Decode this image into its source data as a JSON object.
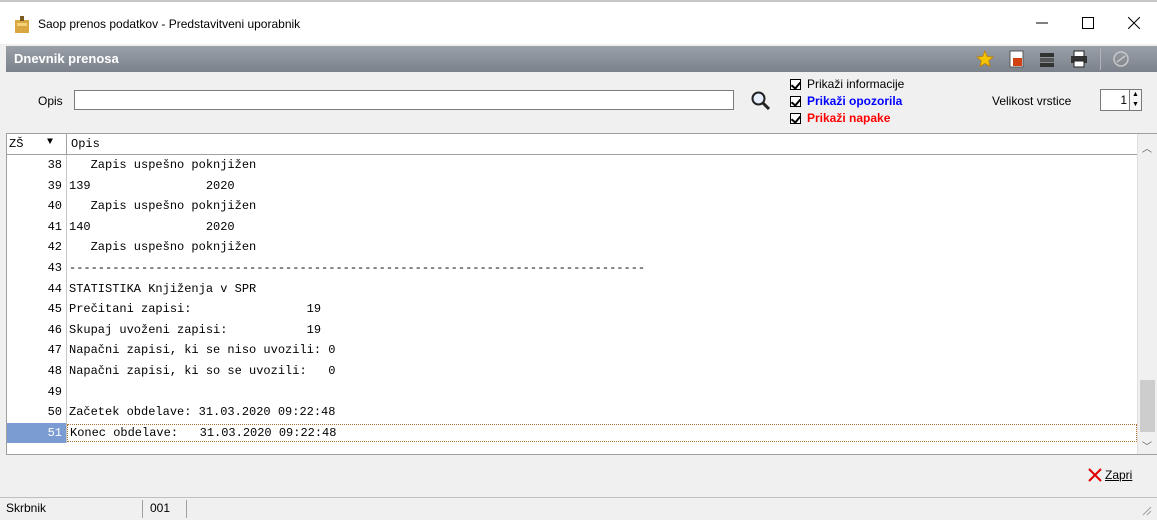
{
  "window": {
    "title": "Saop prenos podatkov - Predstavitveni uporabnik",
    "controls": {
      "minimize": "—",
      "maximize": "☐",
      "close": "✕"
    }
  },
  "header": {
    "title": "Dnevnik prenosa",
    "toolbar_icons": [
      "star-icon",
      "export-icon",
      "database-icon",
      "print-icon",
      "disabled-tool-icon"
    ]
  },
  "filter": {
    "opis_label": "Opis",
    "opis_value": "",
    "checkboxes": [
      {
        "label": "Prikaži informacije",
        "checked": true,
        "color": "#000000"
      },
      {
        "label": "Prikaži opozorila",
        "checked": true,
        "color": "#0000ff"
      },
      {
        "label": "Prikaži napake",
        "checked": true,
        "color": "#ff0000"
      }
    ],
    "row_size_label": "Velikost vrstice",
    "row_size_value": "1"
  },
  "grid": {
    "col_zs": "ZŠ",
    "col_opis": "Opis",
    "rows": [
      {
        "num": "38",
        "text": "   Zapis uspešno poknjižen"
      },
      {
        "num": "39",
        "text": "139                2020"
      },
      {
        "num": "40",
        "text": "   Zapis uspešno poknjižen"
      },
      {
        "num": "41",
        "text": "140                2020"
      },
      {
        "num": "42",
        "text": "   Zapis uspešno poknjižen"
      },
      {
        "num": "43",
        "text": "--------------------------------------------------------------------------------"
      },
      {
        "num": "44",
        "text": "STATISTIKA Knjiženja v SPR"
      },
      {
        "num": "45",
        "text": "Prečitani zapisi:                19"
      },
      {
        "num": "46",
        "text": "Skupaj uvoženi zapisi:           19"
      },
      {
        "num": "47",
        "text": "Napačni zapisi, ki se niso uvozili: 0"
      },
      {
        "num": "48",
        "text": "Napačni zapisi, ki so se uvozili:   0"
      },
      {
        "num": "49",
        "text": ""
      },
      {
        "num": "50",
        "text": "Začetek obdelave: 31.03.2020 09:22:48"
      },
      {
        "num": "51",
        "text": "Konec obdelave:   31.03.2020 09:22:48"
      }
    ]
  },
  "footer": {
    "close_label": "Zapri"
  },
  "statusbar": {
    "user": "Skrbnik",
    "code": "001"
  },
  "colors": {
    "header_band": "#8a9099",
    "selection": "#7a9cd3",
    "warning_blue": "#0000ff",
    "error_red": "#ff0000"
  }
}
